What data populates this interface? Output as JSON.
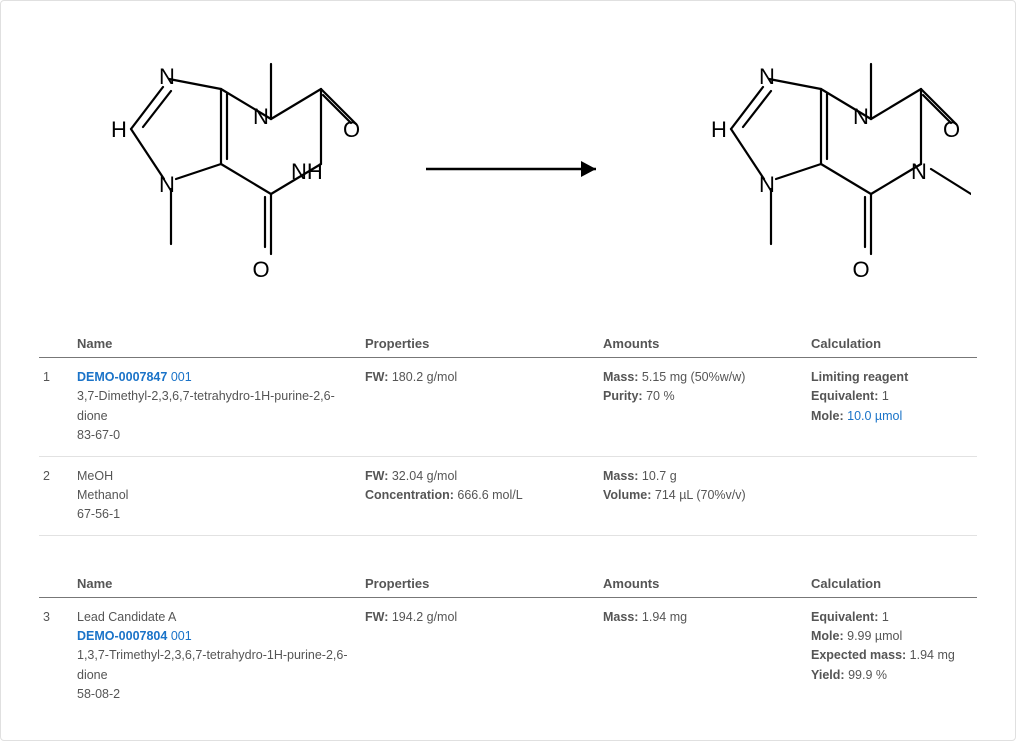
{
  "headers": {
    "name": "Name",
    "properties": "Properties",
    "amounts": "Amounts",
    "calculation": "Calculation"
  },
  "reactants": [
    {
      "idx": "1",
      "demo_id": "DEMO-0007847",
      "demo_suffix": "001",
      "iupac": "3,7-Dimethyl-2,3,6,7-tetrahydro-1H-purine-2,6-dione",
      "cas": "83-67-0",
      "fw_label": "FW:",
      "fw": "180.2 g/mol",
      "mass_label": "Mass:",
      "mass": "5.15 mg (50%w/w)",
      "purity_label": "Purity:",
      "purity": "70 %",
      "limiting": "Limiting reagent",
      "eq_label": "Equivalent:",
      "eq": "1",
      "mole_label": "Mole:",
      "mole": "10.0 µmol"
    },
    {
      "idx": "2",
      "abbr": "MeOH",
      "name": "Methanol",
      "cas": "67-56-1",
      "fw_label": "FW:",
      "fw": "32.04 g/mol",
      "conc_label": "Concentration:",
      "conc": "666.6 mol/L",
      "mass_label": "Mass:",
      "mass": "10.7 g",
      "vol_label": "Volume:",
      "vol": "714 µL (70%v/v)"
    }
  ],
  "products": [
    {
      "idx": "3",
      "lead": "Lead Candidate A",
      "demo_id": "DEMO-0007804",
      "demo_suffix": "001",
      "iupac": "1,3,7-Trimethyl-2,3,6,7-tetrahydro-1H-purine-2,6-dione",
      "cas": "58-08-2",
      "fw_label": "FW:",
      "fw": "194.2 g/mol",
      "mass_label": "Mass:",
      "mass": "1.94 mg",
      "eq_label": "Equivalent:",
      "eq": "1",
      "mole_label": "Mole:",
      "mole": "9.99 µmol",
      "expmass_label": "Expected mass:",
      "expmass": "1.94 mg",
      "yield_label": "Yield:",
      "yield": "99.9 %"
    }
  ]
}
